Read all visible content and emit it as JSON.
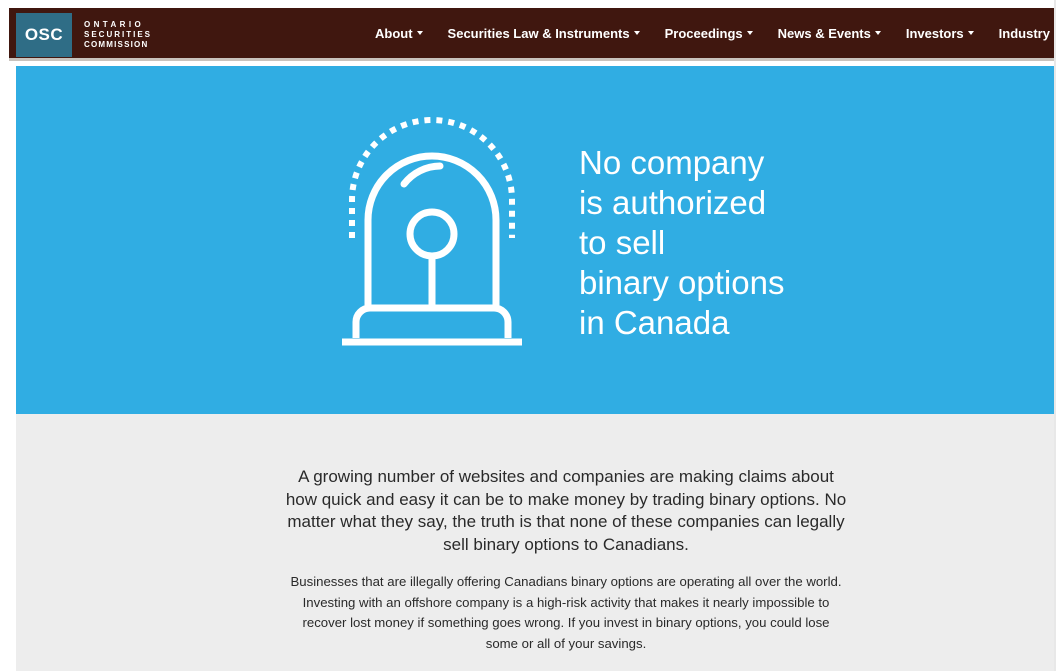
{
  "brand": {
    "abbr": "OSC",
    "line1": "ONTARIO",
    "line2": "SECURITIES",
    "line3": "COMMISSION",
    "box_color": "#2f6d86"
  },
  "nav": {
    "items": [
      {
        "label": "About"
      },
      {
        "label": "Securities Law & Instruments"
      },
      {
        "label": "Proceedings"
      },
      {
        "label": "News & Events"
      },
      {
        "label": "Investors"
      },
      {
        "label": "Industry"
      }
    ],
    "bar_color": "#40170f"
  },
  "hero": {
    "title_lines": [
      "No company",
      "is authorized",
      "to sell",
      "binary options",
      "in Canada"
    ],
    "icon": "alarm-light-icon",
    "background": "#30ade3"
  },
  "content": {
    "lead_lines": [
      "A growing number of websites and companies are making claims about",
      "how quick and easy it can be to make money by trading binary options. No",
      "matter what they say, the truth is that none of these companies can legally",
      "sell binary options to Canadians."
    ],
    "body_lines": [
      "Businesses that are illegally offering Canadians binary options are operating all over the world.",
      "Investing with an offshore company is a high-risk activity that makes it nearly impossible to",
      "recover lost money if something goes wrong. If you invest in binary options, you could lose",
      "some or all of your savings."
    ],
    "background": "#ededed"
  }
}
